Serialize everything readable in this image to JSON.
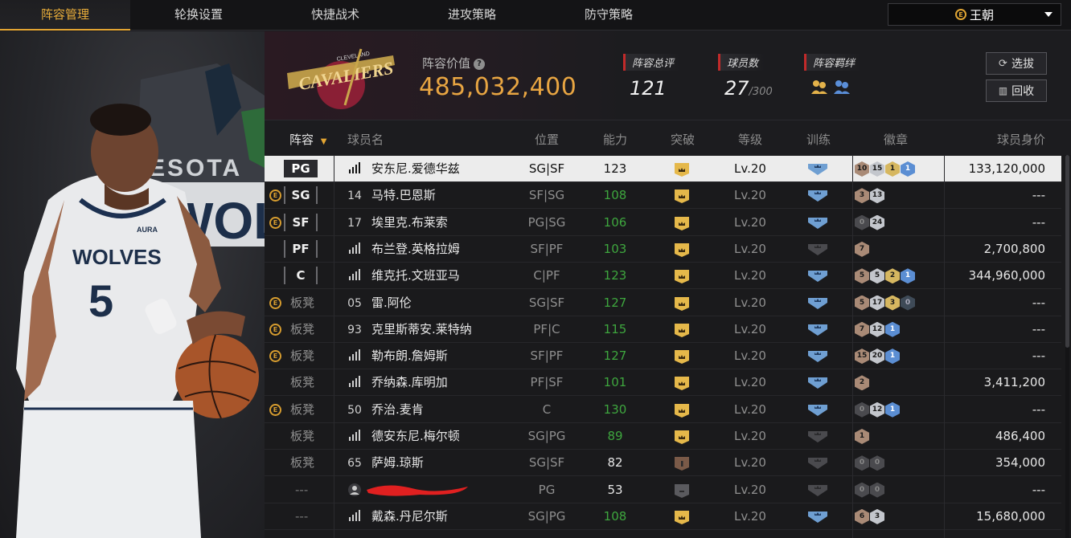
{
  "nav": {
    "tabs": [
      "阵容管理",
      "轮换设置",
      "快捷战术",
      "进攻策略",
      "防守策略"
    ],
    "active_index": 0
  },
  "team_select": {
    "value": "王朝"
  },
  "header": {
    "team_logo_text": "CAVALIERS",
    "team_logo_subtext": "CLEVELAND",
    "value_label": "阵容价值",
    "value": "485,032,400",
    "rating_label": "阵容总评",
    "rating": "121",
    "player_count_label": "球员数",
    "player_count": "27",
    "player_count_max": "/300",
    "bond_label": "阵容羁绊",
    "select_button": "选拔",
    "recycle_button": "回收"
  },
  "table": {
    "columns": [
      "阵容",
      "球员名",
      "位置",
      "能力",
      "突破",
      "等级",
      "训练",
      "徽章",
      "球员身价"
    ],
    "rows": [
      {
        "lineup": "PG",
        "skill": false,
        "jersey": "",
        "name": "安东尼.爱德华兹",
        "position": "SG|SF",
        "rating": "123",
        "rating_color": "#111111",
        "breakthrough": "gold",
        "level": "Lv.20",
        "training": "blue",
        "badges": [
          [
            "10",
            "bronze"
          ],
          [
            "15",
            "silver"
          ],
          [
            "1",
            "gold"
          ],
          [
            "1",
            "blue"
          ]
        ],
        "price": "133,120,000",
        "selected": true
      },
      {
        "lineup": "SG",
        "skill": true,
        "jersey": "14",
        "name": "马特.巴恩斯",
        "position": "SF|SG",
        "rating": "108",
        "rating_color": "#3ea63e",
        "breakthrough": "gold",
        "level": "Lv.20",
        "training": "blue",
        "badges": [
          [
            "3",
            "bronze"
          ],
          [
            "13",
            "silver"
          ]
        ],
        "price": "---"
      },
      {
        "lineup": "SF",
        "skill": true,
        "jersey": "17",
        "name": "埃里克.布莱索",
        "position": "PG|SG",
        "rating": "106",
        "rating_color": "#3ea63e",
        "breakthrough": "gold",
        "level": "Lv.20",
        "training": "blue",
        "badges": [
          [
            "0",
            "dim"
          ],
          [
            "24",
            "silver"
          ]
        ],
        "price": "---"
      },
      {
        "lineup": "PF",
        "skill": false,
        "jersey": "",
        "name": "布兰登.英格拉姆",
        "position": "SF|PF",
        "rating": "103",
        "rating_color": "#3ea63e",
        "breakthrough": "gold",
        "level": "Lv.20",
        "training": "gray",
        "badges": [
          [
            "7",
            "bronze"
          ]
        ],
        "price": "2,700,800"
      },
      {
        "lineup": "C",
        "skill": false,
        "jersey": "",
        "name": "维克托.文班亚马",
        "position": "C|PF",
        "rating": "123",
        "rating_color": "#3ea63e",
        "breakthrough": "gold",
        "level": "Lv.20",
        "training": "blue",
        "badges": [
          [
            "5",
            "bronze"
          ],
          [
            "5",
            "silver"
          ],
          [
            "2",
            "gold"
          ],
          [
            "1",
            "blue"
          ]
        ],
        "price": "344,960,000"
      },
      {
        "lineup": "板凳",
        "skill": true,
        "jersey": "05",
        "name": "雷.阿伦",
        "position": "SG|SF",
        "rating": "127",
        "rating_color": "#3ea63e",
        "breakthrough": "gold",
        "level": "Lv.20",
        "training": "blue",
        "badges": [
          [
            "5",
            "bronze"
          ],
          [
            "17",
            "silver"
          ],
          [
            "3",
            "gold"
          ],
          [
            "0",
            "dark"
          ]
        ],
        "price": "---"
      },
      {
        "lineup": "板凳",
        "skill": true,
        "jersey": "93",
        "name": "克里斯蒂安.莱特纳",
        "position": "PF|C",
        "rating": "115",
        "rating_color": "#3ea63e",
        "breakthrough": "gold",
        "level": "Lv.20",
        "training": "blue",
        "badges": [
          [
            "7",
            "bronze"
          ],
          [
            "12",
            "silver"
          ],
          [
            "1",
            "blue"
          ]
        ],
        "price": "---"
      },
      {
        "lineup": "板凳",
        "skill": true,
        "jersey": "",
        "name": "勒布朗.詹姆斯",
        "position": "SF|PF",
        "rating": "127",
        "rating_color": "#3ea63e",
        "breakthrough": "gold",
        "level": "Lv.20",
        "training": "blue",
        "badges": [
          [
            "15",
            "bronze"
          ],
          [
            "20",
            "silver"
          ],
          [
            "1",
            "blue"
          ]
        ],
        "price": "---"
      },
      {
        "lineup": "板凳",
        "skill": false,
        "jersey": "",
        "name": "乔纳森.库明加",
        "position": "PF|SF",
        "rating": "101",
        "rating_color": "#3ea63e",
        "breakthrough": "gold",
        "level": "Lv.20",
        "training": "blue",
        "badges": [
          [
            "2",
            "bronze"
          ]
        ],
        "price": "3,411,200"
      },
      {
        "lineup": "板凳",
        "skill": true,
        "jersey": "50",
        "name": "乔治.麦肯",
        "position": "C",
        "rating": "130",
        "rating_color": "#3ea63e",
        "breakthrough": "gold",
        "level": "Lv.20",
        "training": "blue",
        "badges": [
          [
            "0",
            "dim"
          ],
          [
            "12",
            "silver"
          ],
          [
            "1",
            "blue"
          ]
        ],
        "price": "---"
      },
      {
        "lineup": "板凳",
        "skill": false,
        "jersey": "",
        "name": "德安东尼.梅尔顿",
        "position": "SG|PG",
        "rating": "89",
        "rating_color": "#3ea63e",
        "breakthrough": "gold",
        "level": "Lv.20",
        "training": "gray",
        "badges": [
          [
            "1",
            "bronze"
          ]
        ],
        "price": "486,400"
      },
      {
        "lineup": "板凳",
        "skill": false,
        "jersey": "65",
        "name": "萨姆.琼斯",
        "position": "SG|SF",
        "rating": "82",
        "rating_color": "#e6e6e6",
        "breakthrough": "bronze",
        "level": "Lv.20",
        "training": "gray",
        "badges": [
          [
            "0",
            "dim"
          ],
          [
            "0",
            "dim"
          ]
        ],
        "price": "354,000"
      },
      {
        "lineup": "---",
        "skill": false,
        "jersey": "",
        "name": "",
        "redacted": true,
        "position": "PG",
        "rating": "53",
        "rating_color": "#e6e6e6",
        "breakthrough": "gray",
        "level": "Lv.20",
        "training": "gray",
        "badges": [
          [
            "0",
            "dim"
          ],
          [
            "0",
            "dim"
          ]
        ],
        "price": "---"
      },
      {
        "lineup": "---",
        "skill": false,
        "jersey": "",
        "name": "戴森.丹尼尔斯",
        "position": "SG|PG",
        "rating": "108",
        "rating_color": "#3ea63e",
        "breakthrough": "gold",
        "level": "Lv.20",
        "training": "blue",
        "badges": [
          [
            "6",
            "bronze"
          ],
          [
            "3",
            "silver"
          ]
        ],
        "price": "15,680,000"
      }
    ]
  },
  "art": {
    "jersey_team": "WOLVES",
    "jersey_number": "5",
    "jersey_brand": "AURA",
    "backdrop_text_1": "ESOTA",
    "backdrop_text_2": "WOLV"
  }
}
